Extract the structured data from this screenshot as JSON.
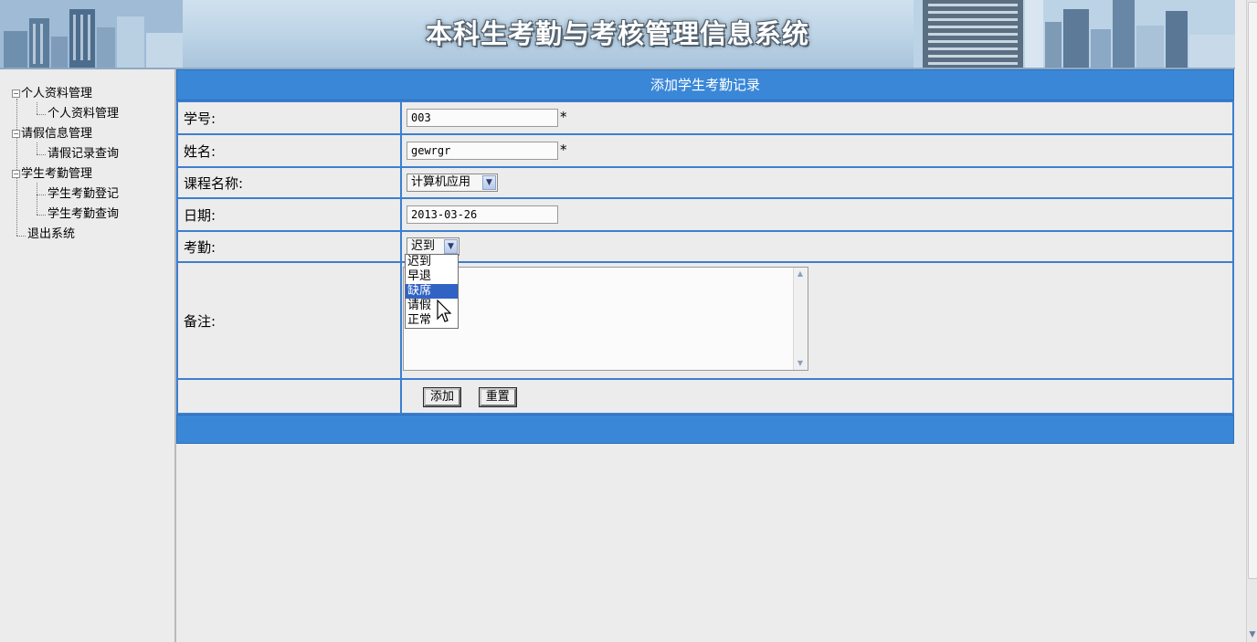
{
  "header": {
    "title": "本科生考勤与考核管理信息系统"
  },
  "sidebar": {
    "groups": [
      {
        "label": "个人资料管理",
        "children": [
          "个人资料管理"
        ]
      },
      {
        "label": "请假信息管理",
        "children": [
          "请假记录查询"
        ]
      },
      {
        "label": "学生考勤管理",
        "children": [
          "学生考勤登记",
          "学生考勤查询"
        ]
      }
    ],
    "exit": "退出系统"
  },
  "form": {
    "title": "添加学生考勤记录",
    "student_id": {
      "label": "学号:",
      "value": "003",
      "required": "*"
    },
    "name": {
      "label": "姓名:",
      "value": "gewrgr",
      "required": "*"
    },
    "course": {
      "label": "课程名称:",
      "value": "计算机应用"
    },
    "date": {
      "label": "日期:",
      "value": "2013-03-26"
    },
    "attendance": {
      "label": "考勤:",
      "value": "迟到",
      "options": [
        "迟到",
        "早退",
        "缺席",
        "请假",
        "正常"
      ],
      "highlighted": "缺席"
    },
    "remark": {
      "label": "备注:",
      "value": ""
    },
    "buttons": {
      "add": "添加",
      "reset": "重置"
    }
  },
  "colors": {
    "accent": "#3a87d8",
    "border": "#3c7fd0",
    "highlight": "#3163c5"
  }
}
